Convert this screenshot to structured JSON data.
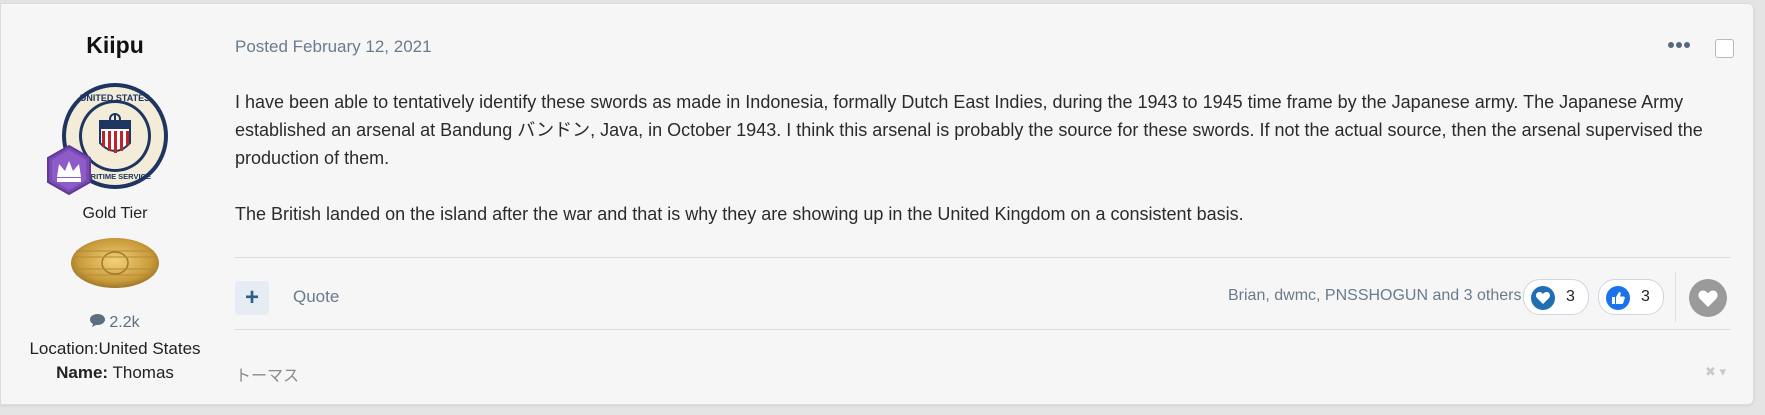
{
  "author": {
    "name": "Kiipu",
    "avatar_text_top": "UNITED STATES",
    "avatar_text_bottom": "MARITIME SERVICE",
    "tier": "Gold Tier",
    "posts_count": "2.2k",
    "location": "Location:United States",
    "name_label": "Name:",
    "name_value": "Thomas"
  },
  "post": {
    "posted": "Posted February 12, 2021",
    "paragraphs": [
      "I have been able to tentatively identify these swords as made in Indonesia, formally Dutch East Indies, during the 1943 to 1945 time frame by the Japanese army.  The Japanese Army established an arsenal at Bandung バンドン, Java, in October 1943.  I think this arsenal is probably the source for these swords.  If not the actual source, then the arsenal supervised the production of them.",
      "The British landed on the island after the war and that is why they are showing up in the United Kingdom on a consistent basis."
    ],
    "plus_label": "+",
    "quote_label": "Quote",
    "reactors": "Brian, dwmc, PNSSHOGUN and 3 others",
    "reactions": [
      {
        "icon": "heart-reaction-icon",
        "count": "3",
        "color": "#1f6fb2"
      },
      {
        "icon": "thumbs-up-reaction-icon",
        "count": "3",
        "color": "#1a73e8"
      }
    ],
    "signature": "トーマス"
  },
  "colors": {
    "meta_text": "#6a7b8d",
    "plus_bg": "#e5ecf3",
    "badge_purple": "#7a4ab6"
  }
}
